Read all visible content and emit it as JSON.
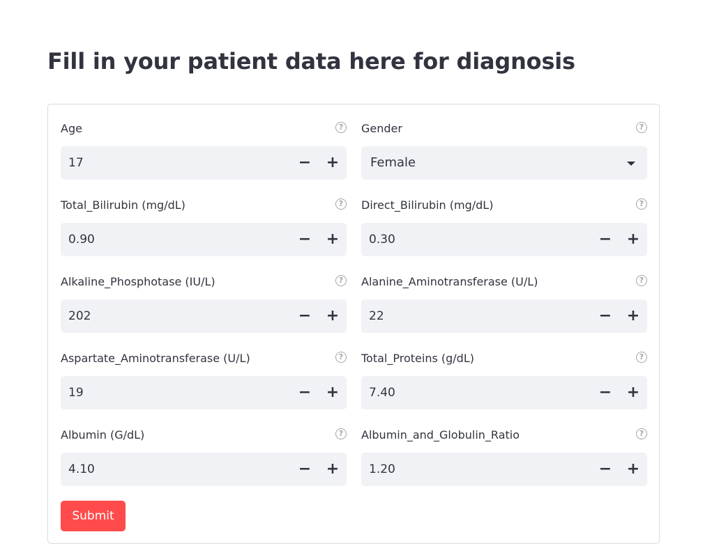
{
  "page": {
    "title": "Fill in your patient data here for diagnosis"
  },
  "help_glyph": "?",
  "stepper": {
    "minus": "−",
    "plus": "+"
  },
  "fields": {
    "age": {
      "label": "Age",
      "value": "17"
    },
    "gender": {
      "label": "Gender",
      "value": "Female"
    },
    "total_bilirubin": {
      "label": "Total_Bilirubin (mg/dL)",
      "value": "0.90"
    },
    "direct_bilirubin": {
      "label": "Direct_Bilirubin (mg/dL)",
      "value": "0.30"
    },
    "alkaline_phosphotase": {
      "label": "Alkaline_Phosphotase (IU/L)",
      "value": "202"
    },
    "alanine_aminotransferase": {
      "label": "Alanine_Aminotransferase (U/L)",
      "value": "22"
    },
    "aspartate_aminotransferase": {
      "label": "Aspartate_Aminotransferase (U/L)",
      "value": "19"
    },
    "total_proteins": {
      "label": "Total_Proteins (g/dL)",
      "value": "7.40"
    },
    "albumin": {
      "label": "Albumin (G/dL)",
      "value": "4.10"
    },
    "albumin_globulin_ratio": {
      "label": "Albumin_and_Globulin_Ratio",
      "value": "1.20"
    }
  },
  "submit_label": "Submit",
  "colors": {
    "accent": "#ff4b4b",
    "input_background": "#f0f2f6",
    "text": "#31333f",
    "border": "#d9dadf"
  }
}
